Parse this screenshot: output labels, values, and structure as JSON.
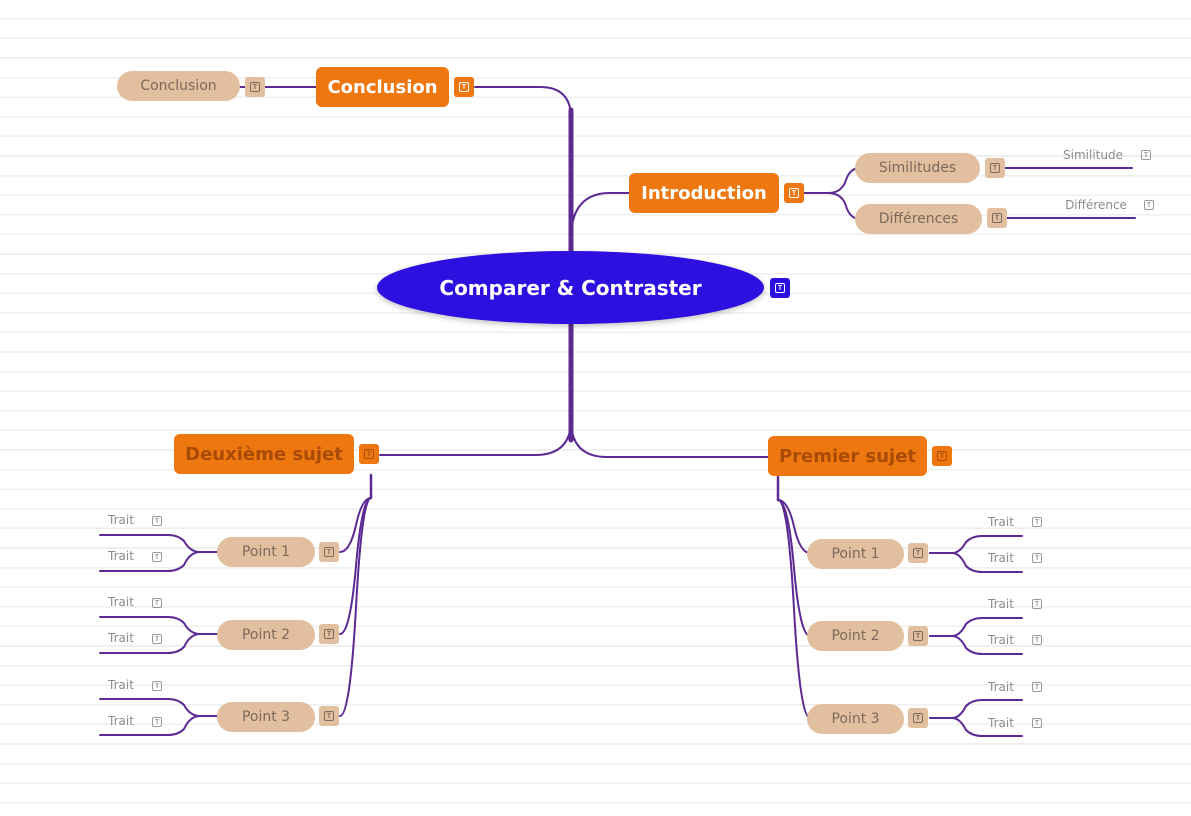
{
  "theme": {
    "central_color": "#2d0fdf",
    "main_color": "#ee7710",
    "sub_color": "#e2bf9f",
    "line_color": "#5c2a93"
  },
  "central": {
    "label": "Comparer & Contraster",
    "note_icon": "text-note-icon"
  },
  "branches": {
    "conclusion": {
      "label": "Conclusion",
      "children": [
        {
          "label": "Conclusion"
        }
      ]
    },
    "introduction": {
      "label": "Introduction",
      "children": [
        {
          "label": "Similitudes",
          "children": [
            {
              "label": "Similitude"
            }
          ]
        },
        {
          "label": "Différences",
          "children": [
            {
              "label": "Différence"
            }
          ]
        }
      ]
    },
    "deuxieme": {
      "label": "Deuxième sujet",
      "children": [
        {
          "label": "Point 1",
          "children": [
            {
              "label": "Trait"
            },
            {
              "label": "Trait"
            }
          ]
        },
        {
          "label": "Point 2",
          "children": [
            {
              "label": "Trait"
            },
            {
              "label": "Trait"
            }
          ]
        },
        {
          "label": "Point 3",
          "children": [
            {
              "label": "Trait"
            },
            {
              "label": "Trait"
            }
          ]
        }
      ]
    },
    "premier": {
      "label": "Premier sujet",
      "children": [
        {
          "label": "Point 1",
          "children": [
            {
              "label": "Trait"
            },
            {
              "label": "Trait"
            }
          ]
        },
        {
          "label": "Point 2",
          "children": [
            {
              "label": "Trait"
            },
            {
              "label": "Trait"
            }
          ]
        },
        {
          "label": "Point 3",
          "children": [
            {
              "label": "Trait"
            },
            {
              "label": "Trait"
            }
          ]
        }
      ]
    }
  },
  "note_glyph": "T"
}
